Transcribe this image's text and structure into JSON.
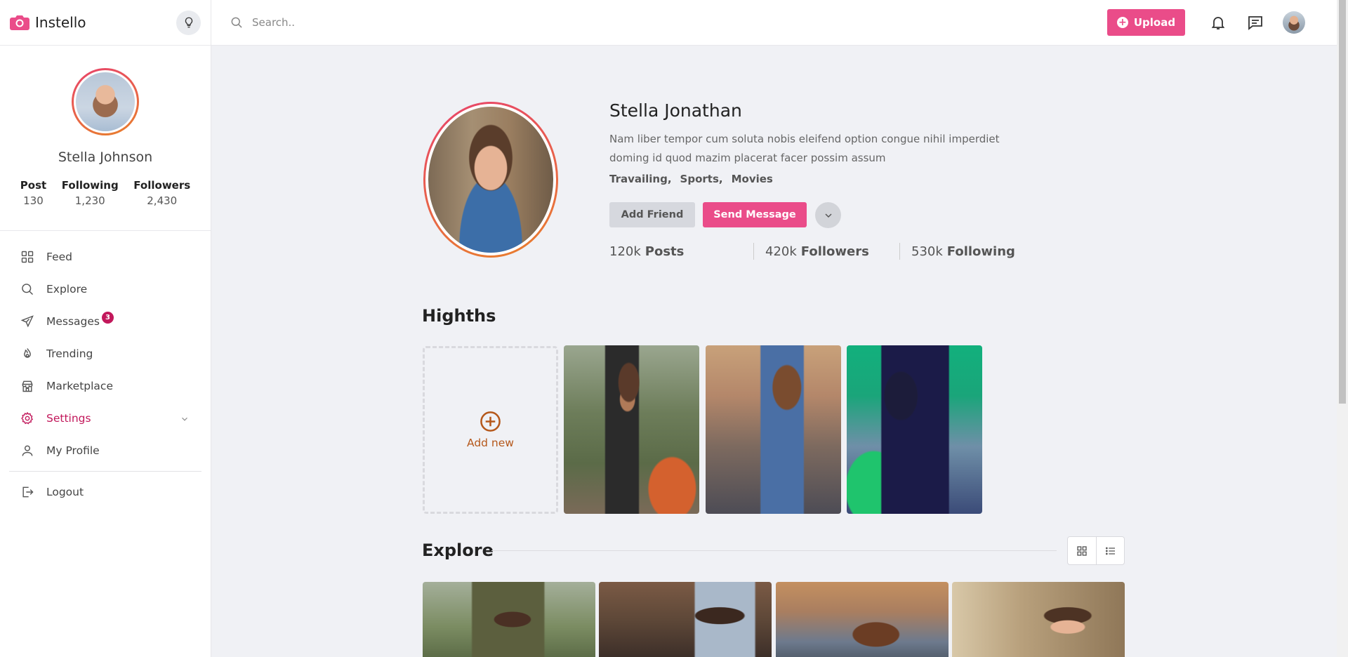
{
  "app": {
    "name": "Instello"
  },
  "sidebar": {
    "user_name": "Stella Johnson",
    "stats": [
      {
        "label": "Post",
        "value": "130"
      },
      {
        "label": "Following",
        "value": "1,230"
      },
      {
        "label": "Followers",
        "value": "2,430"
      }
    ],
    "nav": [
      {
        "label": "Feed",
        "icon": "grid-icon"
      },
      {
        "label": "Explore",
        "icon": "search-icon"
      },
      {
        "label": "Messages",
        "icon": "send-icon",
        "badge": "3"
      },
      {
        "label": "Trending",
        "icon": "flame-icon"
      },
      {
        "label": "Marketplace",
        "icon": "store-icon"
      },
      {
        "label": "Settings",
        "icon": "gear-icon",
        "active": true
      },
      {
        "label": "My Profile",
        "icon": "user-icon"
      }
    ],
    "logout_label": "Logout"
  },
  "topbar": {
    "search_placeholder": "Search..",
    "upload_label": "Upload"
  },
  "profile": {
    "name": "Stella Jonathan",
    "bio": "Nam liber tempor cum soluta nobis eleifend option congue nihil imperdiet doming id quod mazim placerat facer possim assum",
    "tags": [
      "Travailing,",
      "Sports,",
      "Movies"
    ],
    "add_friend_label": "Add Friend",
    "send_message_label": "Send Message",
    "stats": [
      {
        "value": "120k",
        "label": "Posts"
      },
      {
        "value": "420k",
        "label": "Followers"
      },
      {
        "value": "530k",
        "label": "Following"
      }
    ]
  },
  "highlights": {
    "title": "Highths",
    "add_new_label": "Add new"
  },
  "explore": {
    "title": "Explore"
  },
  "colors": {
    "accent": "#ea4c89",
    "active_nav": "#c2185b",
    "add_new": "#b5581b"
  }
}
